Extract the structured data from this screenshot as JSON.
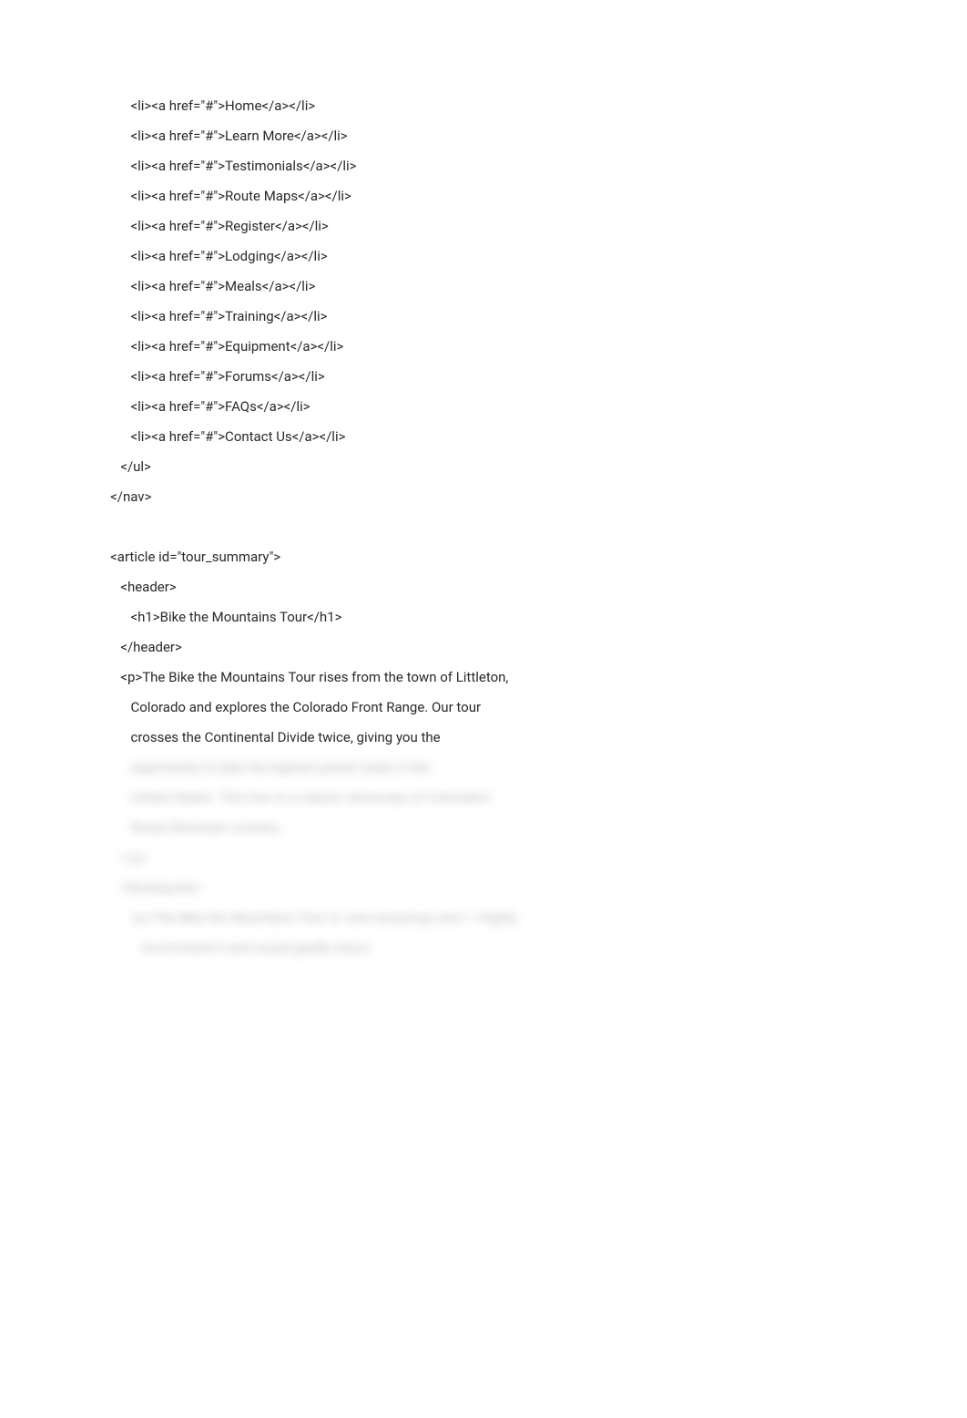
{
  "code_lines": [
    {
      "indent": 3,
      "text": "<li><a href=\"#\">Home</a></li>",
      "blurred": false
    },
    {
      "indent": 3,
      "text": "<li><a href=\"#\">Learn More</a></li>",
      "blurred": false
    },
    {
      "indent": 3,
      "text": "<li><a href=\"#\">Testimonials</a></li>",
      "blurred": false
    },
    {
      "indent": 3,
      "text": "<li><a href=\"#\">Route Maps</a></li>",
      "blurred": false
    },
    {
      "indent": 3,
      "text": "<li><a href=\"#\">Register</a></li>",
      "blurred": false
    },
    {
      "indent": 3,
      "text": "<li><a href=\"#\">Lodging</a></li>",
      "blurred": false
    },
    {
      "indent": 3,
      "text": "<li><a href=\"#\">Meals</a></li>",
      "blurred": false
    },
    {
      "indent": 3,
      "text": "<li><a href=\"#\">Training</a></li>",
      "blurred": false
    },
    {
      "indent": 3,
      "text": "<li><a href=\"#\">Equipment</a></li>",
      "blurred": false
    },
    {
      "indent": 3,
      "text": "<li><a href=\"#\">Forums</a></li>",
      "blurred": false
    },
    {
      "indent": 3,
      "text": "<li><a href=\"#\">FAQs</a></li>",
      "blurred": false
    },
    {
      "indent": 3,
      "text": "<li><a href=\"#\">Contact Us</a></li>",
      "blurred": false
    },
    {
      "indent": 2,
      "text": "</ul>",
      "blurred": false
    },
    {
      "indent": 1,
      "text": "</nav>",
      "blurred": false
    },
    {
      "indent": 0,
      "text": "",
      "blurred": false,
      "spacer": true
    },
    {
      "indent": 1,
      "text": "<article id=\"tour_summary\">",
      "blurred": false
    },
    {
      "indent": 2,
      "text": "<header>",
      "blurred": false
    },
    {
      "indent": 3,
      "text": "<h1>Bike the Mountains Tour</h1>",
      "blurred": false
    },
    {
      "indent": 2,
      "text": "</header>",
      "blurred": false
    },
    {
      "indent": 2,
      "text": "<p>The Bike the Mountains Tour rises from the town of Littleton,",
      "blurred": false
    },
    {
      "indent": 3,
      "text": "Colorado and explores the Colorado Front Range. Our tour",
      "blurred": false
    },
    {
      "indent": 3,
      "text": "crosses the Continental Divide twice, giving you the",
      "blurred": false
    },
    {
      "indent": 3,
      "text": "opportunity to bike the highest paved roads in the",
      "blurred": true
    },
    {
      "indent": 3,
      "text": "United States. This tour is a classic showcase of Colorado's",
      "blurred": true
    },
    {
      "indent": 3,
      "text": "Rocky Mountain scenery.",
      "blurred": true
    },
    {
      "indent": 2,
      "text": "</p>",
      "blurred": true
    },
    {
      "indent": 2,
      "text": "<blockquote>",
      "blurred": true
    },
    {
      "indent": 3,
      "text": "<p>The Bike the Mountains Tour is <em>amazing</em>. I highly",
      "blurred": true
    },
    {
      "indent": 4,
      "text": "recommend it and would gladly return.",
      "blurred": true
    }
  ],
  "indent_unit": "   "
}
